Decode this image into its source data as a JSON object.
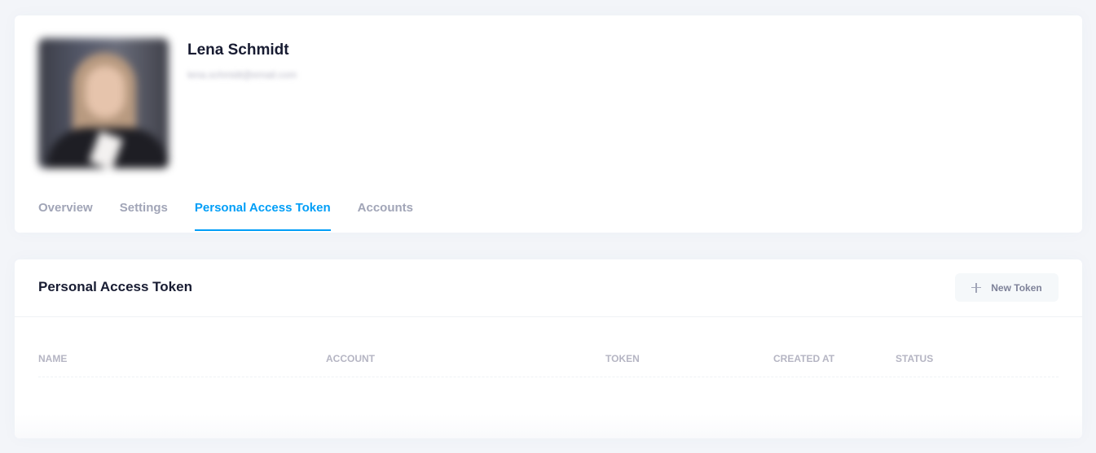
{
  "profile": {
    "name": "Lena Schmidt",
    "email": "lena.schmidt@email.com"
  },
  "tabs": [
    {
      "label": "Overview",
      "active": false
    },
    {
      "label": "Settings",
      "active": false
    },
    {
      "label": "Personal Access Token",
      "active": true
    },
    {
      "label": "Accounts",
      "active": false
    }
  ],
  "token_section": {
    "title": "Personal Access Token",
    "new_token_label": "New Token",
    "new_token_icon": "plus-icon",
    "columns": [
      "NAME",
      "ACCOUNT",
      "TOKEN",
      "CREATED AT",
      "STATUS"
    ],
    "rows": []
  },
  "colors": {
    "accent": "#009ef7",
    "page_background": "#f3f5f9",
    "muted_text": "#a1a5b7"
  }
}
